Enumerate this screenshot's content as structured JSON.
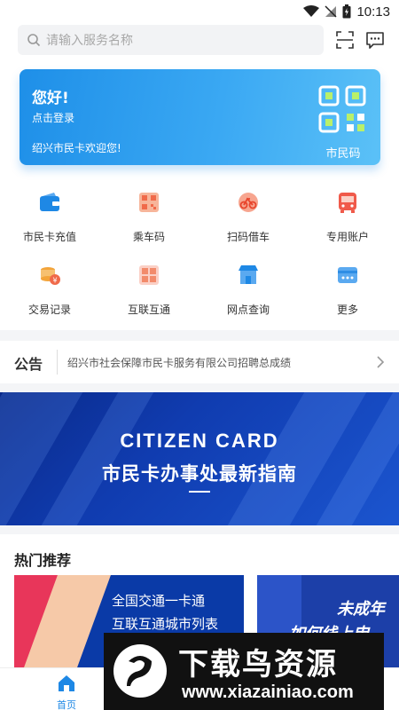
{
  "status_bar": {
    "time": "10:13"
  },
  "search": {
    "placeholder": "请输入服务名称"
  },
  "card": {
    "greeting": "您好!",
    "login": "点击登录",
    "welcome": "绍兴市民卡欢迎您!",
    "qr_label": "市民码"
  },
  "services": [
    {
      "label": "市民卡充值",
      "icon": "wallet-icon",
      "color": "#1e88e5"
    },
    {
      "label": "乘车码",
      "icon": "bus-qr-icon",
      "color": "#f28b6b"
    },
    {
      "label": "扫码借车",
      "icon": "bike-icon",
      "color": "#f06a4a"
    },
    {
      "label": "专用账户",
      "icon": "bus-icon",
      "color": "#f05a4a"
    },
    {
      "label": "交易记录",
      "icon": "coins-icon",
      "color": "#f3a43a"
    },
    {
      "label": "互联互通",
      "icon": "qr-link-icon",
      "color": "#f28b6b"
    },
    {
      "label": "网点查询",
      "icon": "store-icon",
      "color": "#1e88e5"
    },
    {
      "label": "更多",
      "icon": "more-icon",
      "color": "#5aa9f0"
    }
  ],
  "notice": {
    "title": "公告",
    "text": "绍兴市社会保障市民卡服务有限公司招聘总成绩"
  },
  "banner": {
    "en": "CITIZEN CARD",
    "cn": "市民卡办事处最新指南"
  },
  "hot": {
    "title": "热门推荐",
    "card1_line1": "全国交通一卡通",
    "card1_line2": "互联互通城市列表",
    "card2_line1": "未成年",
    "card2_line2": "如何线上申"
  },
  "tabbar": {
    "home": "首页"
  },
  "watermark": {
    "big": "下载鸟资源",
    "url": "www.xiazainiao.com"
  },
  "colors": {
    "accent": "#1e88e5",
    "card_start": "#1e8fe8",
    "card_end": "#5bc1f7",
    "banner": "#103cb0"
  }
}
